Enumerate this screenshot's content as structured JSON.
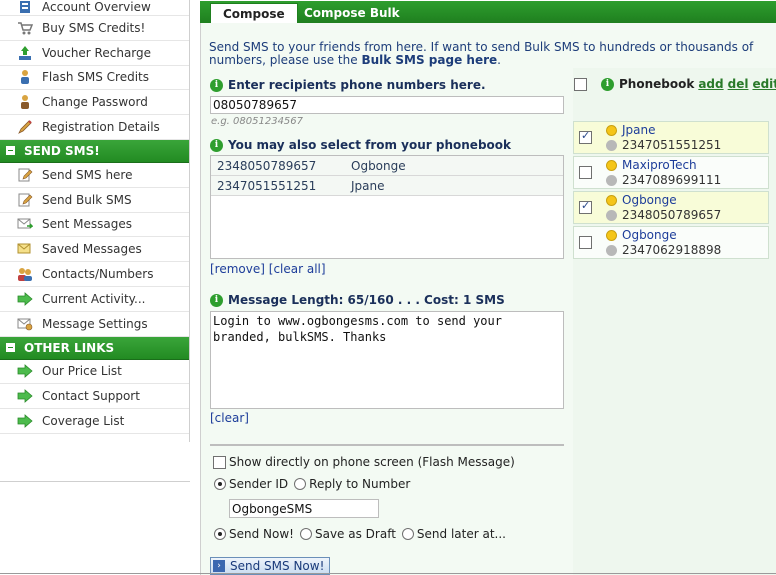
{
  "sidebar": {
    "top_items": [
      {
        "label": "Account Overview",
        "icon": "account-icon"
      },
      {
        "label": "Buy SMS Credits!",
        "icon": "cart-icon"
      },
      {
        "label": "Voucher Recharge",
        "icon": "voucher-icon"
      },
      {
        "label": "Flash SMS Credits",
        "icon": "flash-icon"
      },
      {
        "label": "Change Password",
        "icon": "password-icon"
      },
      {
        "label": "Registration Details",
        "icon": "pencil-icon"
      }
    ],
    "send_sms_title": "SEND SMS!",
    "send_sms_items": [
      {
        "label": "Send SMS here",
        "icon": "pencil-icon"
      },
      {
        "label": "Send Bulk SMS",
        "icon": "pencil-icon"
      },
      {
        "label": "Sent Messages",
        "icon": "sent-icon"
      },
      {
        "label": "Saved Messages",
        "icon": "saved-icon"
      },
      {
        "label": "Contacts/Numbers",
        "icon": "contacts-icon"
      },
      {
        "label": "Current Activity...",
        "icon": "arrow-icon"
      },
      {
        "label": "Message Settings",
        "icon": "settings-icon"
      }
    ],
    "other_links_title": "OTHER LINKS",
    "other_links_items": [
      {
        "label": "Our Price List",
        "icon": "arrow-icon"
      },
      {
        "label": "Contact Support",
        "icon": "arrow-icon"
      },
      {
        "label": "Coverage List",
        "icon": "arrow-icon"
      }
    ]
  },
  "tabs": {
    "compose": "Compose",
    "compose_bulk": "Compose Bulk"
  },
  "intro": {
    "text": "Send SMS to your friends from here. If want to send Bulk SMS to hundreds or thousands of numbers, please use the",
    "link": "Bulk SMS page here",
    "end": "."
  },
  "recipients": {
    "label": "Enter recipients phone numbers here.",
    "value": "08050789657",
    "example": "e.g. 08051234567"
  },
  "phonebook_select": {
    "label": "You may also select from your phonebook",
    "rows": [
      {
        "number": "2348050789657",
        "name": "Ogbonge"
      },
      {
        "number": "2347051551251",
        "name": "Jpane"
      }
    ],
    "remove": "[remove]",
    "clear_all": "[clear all]"
  },
  "message": {
    "label": "Message Length: 65/160 . . . Cost: 1 SMS",
    "text": "Login to www.ogbongesms.com to send your branded, bulkSMS. Thanks",
    "clear": "[clear]"
  },
  "options": {
    "flash_label": "Show directly on phone screen (Flash Message)",
    "sender_id_label": "Sender ID",
    "reply_to_label": "Reply to Number",
    "sender_value": "OgbongeSMS",
    "send_now_label": "Send Now!",
    "save_draft_label": "Save as Draft",
    "send_later_label": "Send later at..."
  },
  "send_button": "Send SMS Now!",
  "phonebook": {
    "title": "Phonebook",
    "add": "add",
    "del": "del",
    "edit": "edit",
    "contacts": [
      {
        "name": "Jpane",
        "phone": "2347051551251",
        "checked": true
      },
      {
        "name": "MaxiproTech",
        "phone": "2347089699111",
        "checked": false
      },
      {
        "name": "Ogbonge",
        "phone": "2348050789657",
        "checked": true
      },
      {
        "name": "Ogbonge",
        "phone": "2347062918898",
        "checked": false
      }
    ]
  },
  "colors": {
    "accent_green": "#228b22",
    "link_blue": "#1d3d9a",
    "phonebook_bg": "#eef7ee",
    "selected_contact_bg": "#f8fcd8"
  }
}
